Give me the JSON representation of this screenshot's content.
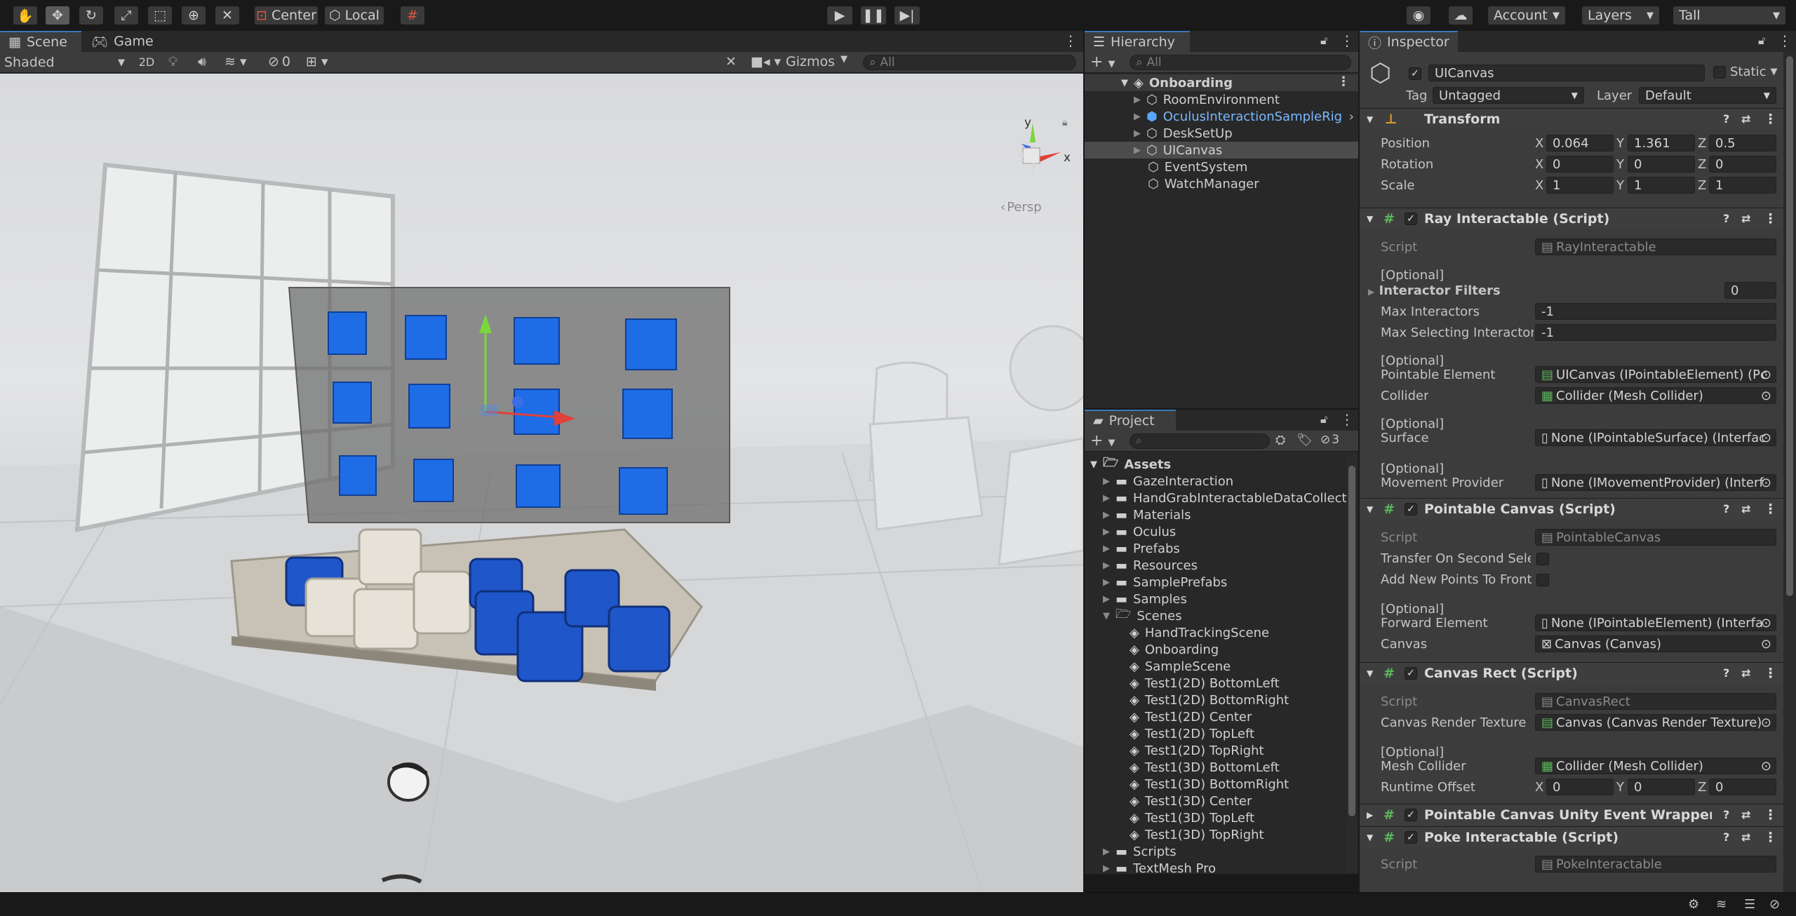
{
  "toolbar": {
    "center_label": "Center",
    "local_label": "Local",
    "account_label": "Account",
    "layers_label": "Layers",
    "layout_label": "Tall"
  },
  "scene_panel": {
    "tab_scene": "Scene",
    "tab_game": "Game",
    "shading_mode": "Shaded",
    "mode_2d": "2D",
    "hidden_count": "0",
    "gizmos_label": "Gizmos",
    "search_placeholder": "All",
    "persp_label": "Persp",
    "axis_y": "y",
    "axis_x": "x"
  },
  "hierarchy": {
    "title": "Hierarchy",
    "search_placeholder": "All",
    "scene_name": "Onboarding",
    "items": [
      {
        "label": "RoomEnvironment",
        "expandable": true,
        "prefab": false
      },
      {
        "label": "OculusInteractionSampleRig",
        "expandable": true,
        "prefab": true
      },
      {
        "label": "DeskSetUp",
        "expandable": true,
        "prefab": false
      },
      {
        "label": "UICanvas",
        "expandable": true,
        "prefab": false
      },
      {
        "label": "EventSystem",
        "expandable": false,
        "prefab": false
      },
      {
        "label": "WatchManager",
        "expandable": false,
        "prefab": false
      }
    ]
  },
  "project": {
    "title": "Project",
    "hidden_count": "3",
    "root": "Assets",
    "folders": [
      "GazeInteraction",
      "HandGrabInteractableDataCollect",
      "Materials",
      "Oculus",
      "Prefabs",
      "Resources",
      "SamplePrefabs",
      "Samples"
    ],
    "open_folder": "Scenes",
    "scenes": [
      "HandTrackingScene",
      "Onboarding",
      "SampleScene",
      "Test1(2D) BottomLeft",
      "Test1(2D) BottomRight",
      "Test1(2D) Center",
      "Test1(2D) TopLeft",
      "Test1(2D) TopRight",
      "Test1(3D) BottomLeft",
      "Test1(3D) BottomRight",
      "Test1(3D) Center",
      "Test1(3D) TopLeft",
      "Test1(3D) TopRight"
    ],
    "after": [
      "Scripts",
      "TextMesh Pro"
    ]
  },
  "inspector": {
    "title": "Inspector",
    "object_name": "UICanvas",
    "static_label": "Static",
    "tag_label": "Tag",
    "tag_value": "Untagged",
    "layer_label": "Layer",
    "layer_value": "Default",
    "transform": {
      "title": "Transform",
      "position_label": "Position",
      "rotation_label": "Rotation",
      "scale_label": "Scale",
      "position": [
        "0.064",
        "1.361",
        "0.5"
      ],
      "rotation": [
        "0",
        "0",
        "0"
      ],
      "scale": [
        "1",
        "1",
        "1"
      ]
    },
    "ray": {
      "title": "Ray Interactable (Script)",
      "script_label": "Script",
      "script_value": "RayInteractable",
      "optional": "[Optional]",
      "filters_label": "Interactor Filters",
      "filters_value": "0",
      "max_interactors_label": "Max Interactors",
      "max_interactors_value": "-1",
      "max_selecting_label": "Max Selecting Interactors",
      "max_selecting_value": "-1",
      "pointable_label": "Pointable Element",
      "pointable_value": "UICanvas (IPointableElement) (Pc",
      "collider_label": "Collider",
      "collider_value": "Collider (Mesh Collider)",
      "surface_label": "Surface",
      "surface_value": "None (IPointableSurface) (Interfac",
      "movement_label": "Movement Provider",
      "movement_value": "None (IMovementProvider) (Interf"
    },
    "pointable_canvas": {
      "title": "Pointable Canvas (Script)",
      "script_label": "Script",
      "script_value": "PointableCanvas",
      "transfer_label": "Transfer On Second Selection",
      "add_points_label": "Add New Points To Front",
      "optional": "[Optional]",
      "forward_label": "Forward Element",
      "forward_value": "None (IPointableElement) (Interfa",
      "canvas_label": "Canvas",
      "canvas_value": "Canvas (Canvas)"
    },
    "canvas_rect": {
      "title": "Canvas Rect (Script)",
      "script_label": "Script",
      "script_value": "CanvasRect",
      "render_tex_label": "Canvas Render Texture",
      "render_tex_value": "Canvas (Canvas Render Texture)",
      "optional": "[Optional]",
      "mesh_collider_label": "Mesh Collider",
      "mesh_collider_value": "Collider (Mesh Collider)",
      "runtime_offset_label": "Runtime Offset",
      "runtime_offset": [
        "0",
        "0",
        "0"
      ]
    },
    "wrapper_title": "Pointable Canvas Unity Event Wrapper (Script)",
    "poke": {
      "title": "Poke Interactable (Script)",
      "script_label": "Script",
      "script_value": "PokeInteractable"
    }
  },
  "colors": {
    "accent": "#3a79bb",
    "prefab_text": "#7ab7ff",
    "cube_blue": "#1e6de6"
  }
}
